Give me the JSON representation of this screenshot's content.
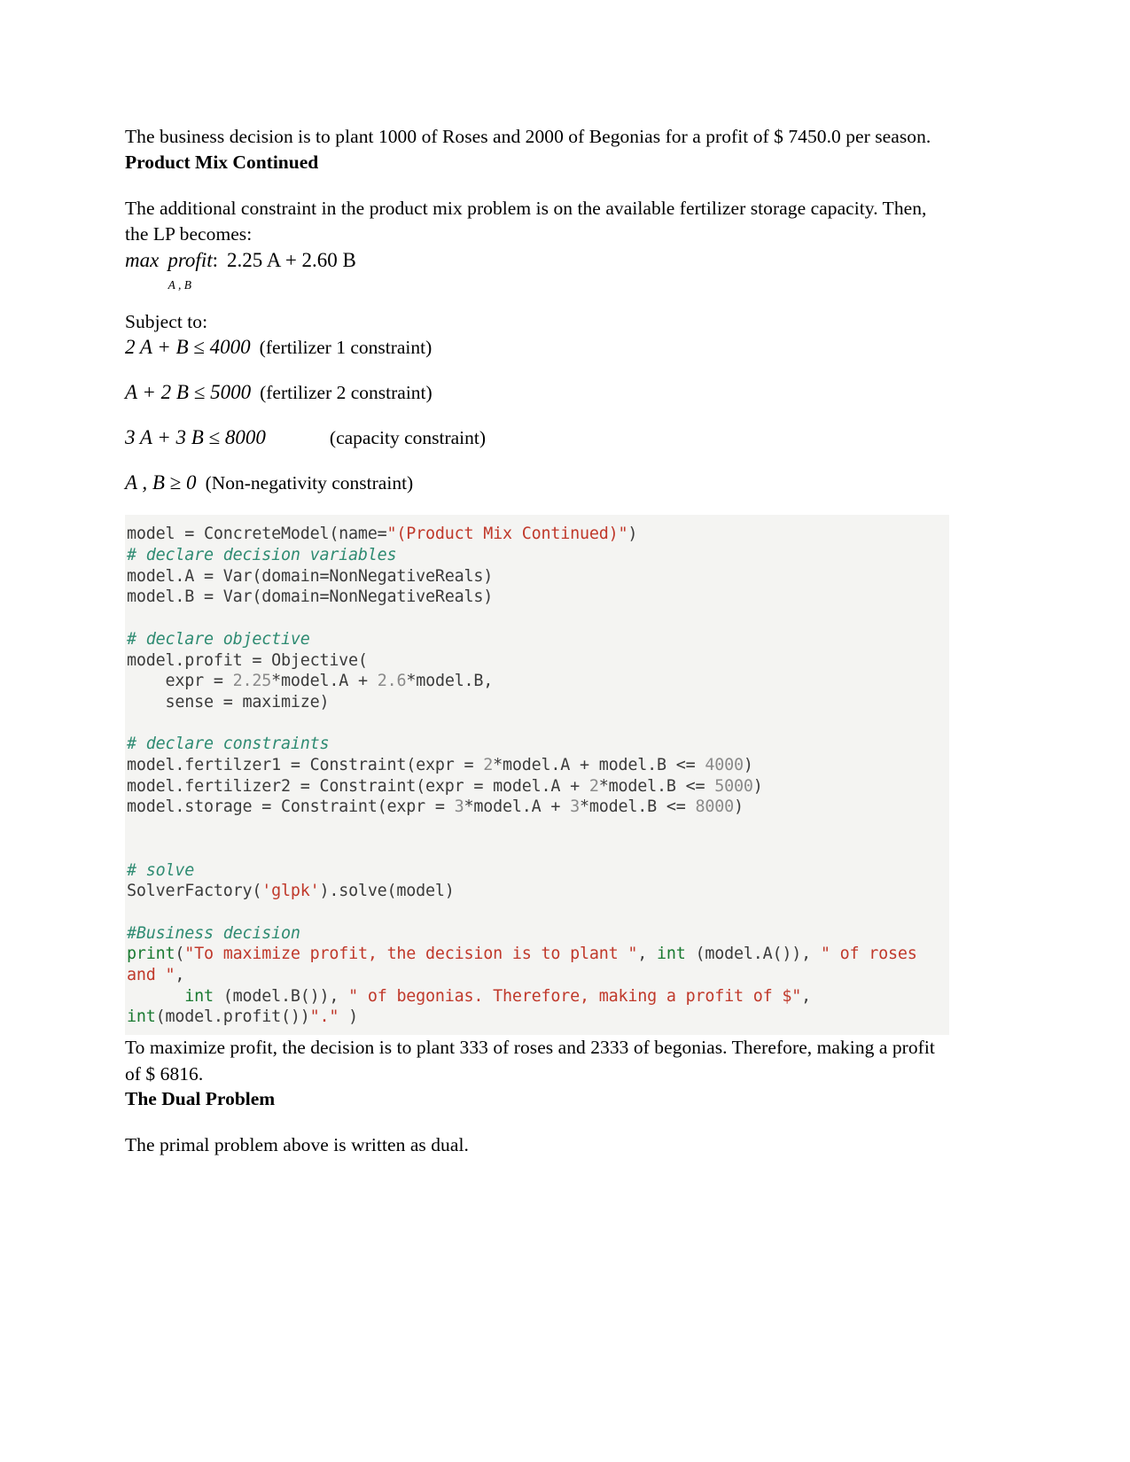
{
  "document": {
    "intro_paragraph": "The business decision is to plant 1000 of Roses and 2000 of Begonias for a profit of $ 7450.0 per season.",
    "section_heading": "Product Mix Continued",
    "section_intro": "The additional constraint in the product mix problem is on the available fertilizer storage capacity. Then, the LP becomes:",
    "objective": {
      "max_label": "max",
      "profit_label": "profit",
      "subscript": "A , B",
      "colon": ":",
      "expression": "2.25 A + 2.60 B"
    },
    "subject_to_label": "Subject to:",
    "constraints": [
      {
        "expr": "2 A + B ≤ 4000",
        "note": "(fertilizer 1 constraint)",
        "wide_gap": false
      },
      {
        "expr": "A + 2 B ≤ 5000",
        "note": "(fertilizer 2 constraint)",
        "wide_gap": false
      },
      {
        "expr": "3 A + 3 B ≤ 8000",
        "note": "(capacity constraint)",
        "wide_gap": true
      },
      {
        "expr": "A , B ≥ 0",
        "note": "(Non-negativity constraint)",
        "wide_gap": false
      }
    ],
    "code": {
      "language": "python",
      "lines": [
        [
          {
            "t": "model = ConcreteModel(name=",
            "c": "pln"
          },
          {
            "t": "\"(Product Mix Continued)\"",
            "c": "str"
          },
          {
            "t": ")",
            "c": "pln"
          }
        ],
        [
          {
            "t": "# declare decision variables",
            "c": "cm"
          }
        ],
        [
          {
            "t": "model.A = Var(domain=NonNegativeReals)",
            "c": "pln"
          }
        ],
        [
          {
            "t": "model.B = Var(domain=NonNegativeReals)",
            "c": "pln"
          }
        ],
        [],
        [
          {
            "t": "# declare objective",
            "c": "cm"
          }
        ],
        [
          {
            "t": "model.profit = Objective(",
            "c": "pln"
          }
        ],
        [
          {
            "t": "    expr = ",
            "c": "pln"
          },
          {
            "t": "2.25",
            "c": "num"
          },
          {
            "t": "*model.A + ",
            "c": "pln"
          },
          {
            "t": "2.6",
            "c": "num"
          },
          {
            "t": "*model.B,",
            "c": "pln"
          }
        ],
        [
          {
            "t": "    sense = maximize)",
            "c": "pln"
          }
        ],
        [],
        [
          {
            "t": "# declare constraints",
            "c": "cm"
          }
        ],
        [
          {
            "t": "model.fertilzer1 = Constraint(expr = ",
            "c": "pln"
          },
          {
            "t": "2",
            "c": "num"
          },
          {
            "t": "*model.A + model.B <= ",
            "c": "pln"
          },
          {
            "t": "4000",
            "c": "num"
          },
          {
            "t": ")",
            "c": "pln"
          }
        ],
        [
          {
            "t": "model.fertilizer2 = Constraint(expr = model.A + ",
            "c": "pln"
          },
          {
            "t": "2",
            "c": "num"
          },
          {
            "t": "*model.B <= ",
            "c": "pln"
          },
          {
            "t": "5000",
            "c": "num"
          },
          {
            "t": ")",
            "c": "pln"
          }
        ],
        [
          {
            "t": "model.storage = Constraint(expr = ",
            "c": "pln"
          },
          {
            "t": "3",
            "c": "num"
          },
          {
            "t": "*model.A + ",
            "c": "pln"
          },
          {
            "t": "3",
            "c": "num"
          },
          {
            "t": "*model.B <= ",
            "c": "pln"
          },
          {
            "t": "8000",
            "c": "num"
          },
          {
            "t": ")",
            "c": "pln"
          }
        ],
        [],
        [],
        [
          {
            "t": "# solve",
            "c": "cm"
          }
        ],
        [
          {
            "t": "SolverFactory(",
            "c": "pln"
          },
          {
            "t": "'glpk'",
            "c": "str"
          },
          {
            "t": ").solve(model)",
            "c": "pln"
          }
        ],
        [],
        [
          {
            "t": "#Business decision",
            "c": "cm"
          }
        ],
        [
          {
            "t": "print",
            "c": "bif"
          },
          {
            "t": "(",
            "c": "pln"
          },
          {
            "t": "\"To maximize profit, the decision is to plant \"",
            "c": "str"
          },
          {
            "t": ", ",
            "c": "pln"
          },
          {
            "t": "int",
            "c": "bif"
          },
          {
            "t": " (model.A()), ",
            "c": "pln"
          },
          {
            "t": "\" of roses and \"",
            "c": "str"
          },
          {
            "t": ",",
            "c": "pln"
          }
        ],
        [
          {
            "t": "      ",
            "c": "pln"
          },
          {
            "t": "int",
            "c": "bif"
          },
          {
            "t": " (model.B()), ",
            "c": "pln"
          },
          {
            "t": "\" of begonias. Therefore, making a profit of $\"",
            "c": "str"
          },
          {
            "t": ",",
            "c": "pln"
          }
        ],
        [
          {
            "t": "int",
            "c": "bif"
          },
          {
            "t": "(model.profit())",
            "c": "pln"
          },
          {
            "t": "\".\"",
            "c": "str"
          },
          {
            "t": " )",
            "c": "pln"
          }
        ]
      ]
    },
    "result_paragraph": "To maximize profit, the decision is to plant 333 of roses and 2333 of begonias. Therefore, making a profit of $ 6816.",
    "dual_heading": "The Dual Problem",
    "dual_paragraph": "The primal problem above is written as dual."
  },
  "colors": {
    "code_background": "#f4f4f2",
    "comment": "#2e8b72",
    "string": "#c0392b",
    "number": "#8a8a8a",
    "builtin": "#1a7a31",
    "plain": "#3b3b3b",
    "text": "#000000"
  }
}
